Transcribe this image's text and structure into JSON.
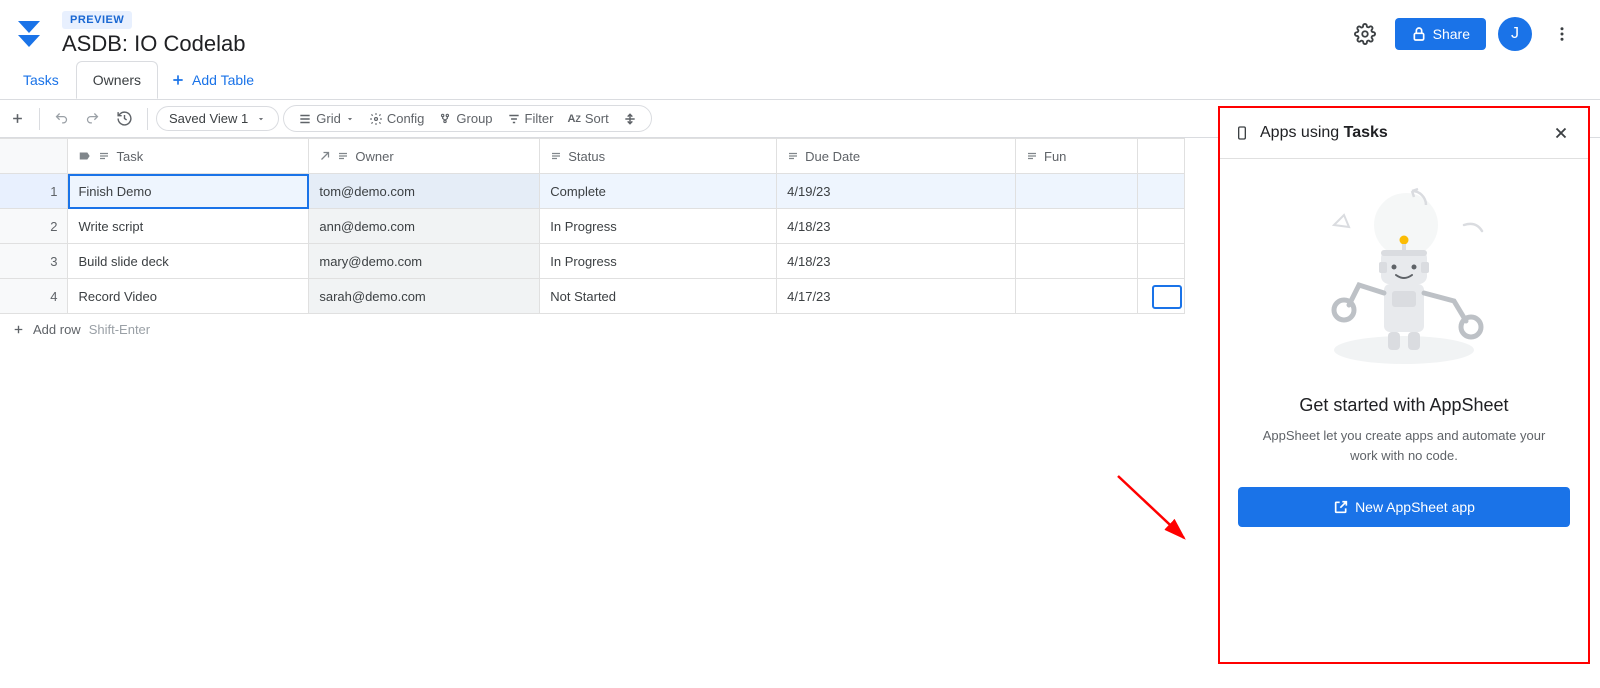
{
  "header": {
    "preview_chip": "PREVIEW",
    "app_title": "ASDB: IO Codelab",
    "share_label": "Share",
    "avatar_letter": "J"
  },
  "tabs": {
    "items": [
      {
        "label": "Tasks"
      },
      {
        "label": "Owners"
      }
    ],
    "add_table": "Add Table"
  },
  "toolbar": {
    "saved_view": "Saved View 1",
    "grid": "Grid",
    "config": "Config",
    "group": "Group",
    "filter": "Filter",
    "sort": "Sort"
  },
  "table": {
    "headers": {
      "task": "Task",
      "owner": "Owner",
      "status": "Status",
      "duedate": "Due Date",
      "fun": "Fun"
    },
    "rows": [
      {
        "n": "1",
        "task": "Finish Demo",
        "owner": "tom@demo.com",
        "status": "Complete",
        "duedate": "4/19/23",
        "fun": ""
      },
      {
        "n": "2",
        "task": "Write script",
        "owner": "ann@demo.com",
        "status": "In Progress",
        "duedate": "4/18/23",
        "fun": ""
      },
      {
        "n": "3",
        "task": "Build slide deck",
        "owner": "mary@demo.com",
        "status": "In Progress",
        "duedate": "4/18/23",
        "fun": ""
      },
      {
        "n": "4",
        "task": "Record Video",
        "owner": "sarah@demo.com",
        "status": "Not Started",
        "duedate": "4/17/23",
        "fun": ""
      }
    ],
    "add_row": "Add row",
    "add_row_hint": "Shift-Enter"
  },
  "panel": {
    "title_prefix": "Apps using ",
    "title_bold": "Tasks",
    "heading": "Get started with AppSheet",
    "desc": "AppSheet let you create apps and automate your work with no code.",
    "button": "New AppSheet app"
  }
}
